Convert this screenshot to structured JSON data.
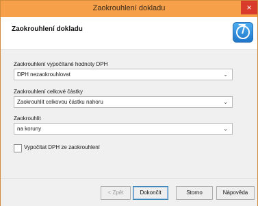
{
  "window": {
    "title": "Zaokrouhlení dokladu",
    "close_label": "×"
  },
  "header": {
    "heading": "Zaokrouhlení dokladu",
    "logo_icon": "logo-icon"
  },
  "form": {
    "vat_rounding": {
      "label": "Zaokrouhlení vypočítané hodnoty DPH",
      "value": "DPH nezaokrouhlovat"
    },
    "total_rounding": {
      "label": "Zaokrouhlení celkové částky",
      "value": "Zaokrouhlit celkovou částku nahoru"
    },
    "round_to": {
      "label": "Zaokrouhlit",
      "value": "na koruny"
    },
    "calc_vat_checkbox": {
      "label": "Vypočítat DPH ze zaokrouhlení",
      "checked": false
    }
  },
  "buttons": {
    "back": "< Zpět",
    "finish": "Dokončit",
    "cancel": "Storno",
    "help": "Nápověda"
  }
}
